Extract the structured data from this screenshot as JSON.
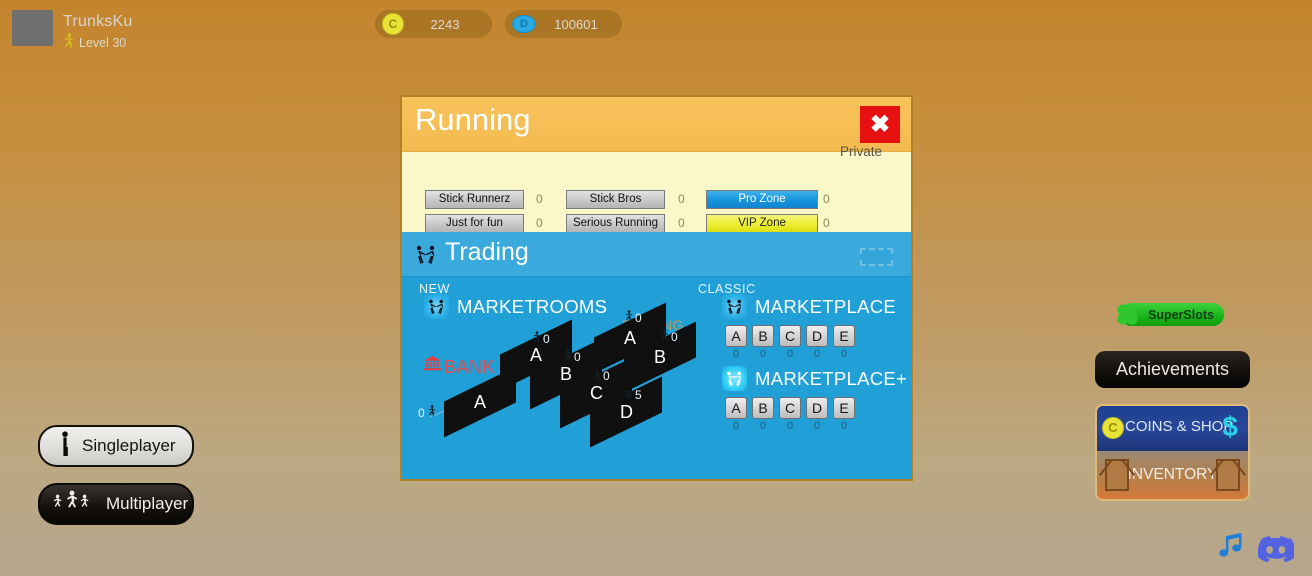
{
  "topbar": {
    "player_name": "TrunksKu",
    "level_text": "Level 30",
    "runner_icon": "runner-icon",
    "coins": {
      "icon": "coin-icon",
      "icon_letter": "C",
      "value": "2243"
    },
    "gems": {
      "icon": "gem-icon",
      "icon_letter": "D",
      "value": "100601"
    }
  },
  "modal": {
    "title": "Running",
    "close_label": "✖",
    "private_label": "Private",
    "zones": [
      {
        "label": "Stick Runnerz",
        "count": "0",
        "style": "grey"
      },
      {
        "label": "Just for fun",
        "count": "0",
        "style": "grey"
      },
      {
        "label": "Stick Bros",
        "count": "0",
        "style": "grey"
      },
      {
        "label": "Serious Running",
        "count": "0",
        "style": "grey"
      },
      {
        "label": "Pro Zone",
        "count": "0",
        "style": "blue"
      },
      {
        "label": "VIP Zone",
        "count": "0",
        "style": "yellow"
      }
    ]
  },
  "trading": {
    "title": "Trading",
    "title_icon": "handshake-icon",
    "window_icon": "window-frame-icon",
    "new_tag": "NEW",
    "classic_tag": "CLASSIC",
    "marketrooms": {
      "heading": "MARKETROOMS",
      "icon": "handshake-icon",
      "bank_label": "BANK",
      "bank_icon": "bank-icon",
      "bidding_label": "BIDDING",
      "rooms": [
        {
          "letter": "A",
          "count": "0",
          "group": "bank"
        },
        {
          "letter": "A",
          "count": "0",
          "group": "main"
        },
        {
          "letter": "B",
          "count": "0",
          "group": "main"
        },
        {
          "letter": "C",
          "count": "0",
          "group": "main"
        },
        {
          "letter": "D",
          "count": "5",
          "group": "main"
        },
        {
          "letter": "A",
          "count": "0",
          "group": "bidding"
        },
        {
          "letter": "B",
          "count": "0",
          "group": "bidding"
        }
      ]
    },
    "marketplace": {
      "heading": "MARKETPLACE",
      "icon": "handshake-icon",
      "tiles": [
        {
          "letter": "A",
          "count": "0"
        },
        {
          "letter": "B",
          "count": "0"
        },
        {
          "letter": "C",
          "count": "0"
        },
        {
          "letter": "D",
          "count": "0"
        },
        {
          "letter": "E",
          "count": "0"
        }
      ]
    },
    "marketplace_plus": {
      "heading": "MARKETPLACE+",
      "icon": "handshake-plus-icon",
      "tiles": [
        {
          "letter": "A",
          "count": "0"
        },
        {
          "letter": "B",
          "count": "0"
        },
        {
          "letter": "C",
          "count": "0"
        },
        {
          "letter": "D",
          "count": "0"
        },
        {
          "letter": "E",
          "count": "0"
        }
      ]
    }
  },
  "left_menu": {
    "singleplayer": {
      "label": "Singleplayer",
      "icon": "single-runner-icon"
    },
    "multiplayer": {
      "label": "Multiplayer",
      "icon": "multi-runner-icon"
    }
  },
  "right_menu": {
    "superslots": {
      "label": "SuperSlots",
      "icon": "clover-icon"
    },
    "achievements": {
      "label": "Achievements"
    },
    "coins_shop": {
      "label": "COINS & SHOP",
      "coin_icon": "coin-icon",
      "coin_letter": "C",
      "dollar_icon": "dollar-icon"
    },
    "inventory": {
      "label": "INVENTORY",
      "crate_icon": "crate-icon"
    }
  },
  "bottom_icons": {
    "music": "music-note-icon",
    "discord": "discord-icon"
  },
  "colors": {
    "background_top": "#c3842c",
    "background_bottom": "#b5a68c",
    "modal_header": "#f6bf56",
    "modal_body": "#faf7c8",
    "trading_panel": "#21a0d8",
    "close_red": "#e81111",
    "pro_zone_blue": "#1494dd",
    "vip_zone_yellow": "#ecec33",
    "bank_red": "#ea4a4a",
    "bidding_gold": "#b79a5c"
  }
}
